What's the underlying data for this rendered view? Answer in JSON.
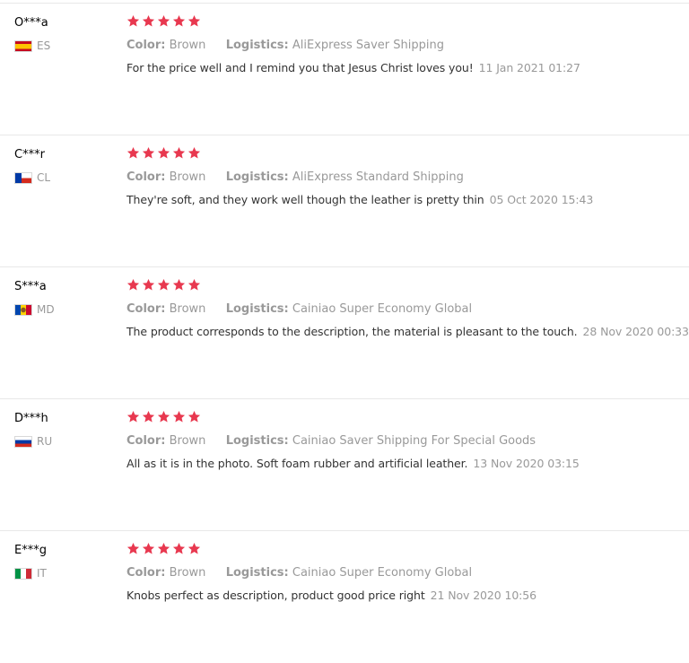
{
  "labels": {
    "color_key": "Color:",
    "logistics_key": "Logistics:"
  },
  "colors": {
    "star": "#e8384f",
    "muted_text": "#999999",
    "body_text": "#333333",
    "divider": "#e8e8e8"
  },
  "reviews": [
    {
      "user": "O***a",
      "country": "ES",
      "flag_icon": "spain-flag-icon",
      "rating": 5,
      "color": "Brown",
      "logistics": "AliExpress Saver Shipping",
      "comment": "For the price well and I remind you that Jesus Christ loves you!",
      "date": "11 Jan 2021 01:27"
    },
    {
      "user": "C***r",
      "country": "CL",
      "flag_icon": "chile-flag-icon",
      "rating": 5,
      "color": "Brown",
      "logistics": "AliExpress Standard Shipping",
      "comment": "They're soft, and they work well though the leather is pretty thin",
      "date": "05 Oct 2020 15:43"
    },
    {
      "user": "S***a",
      "country": "MD",
      "flag_icon": "moldova-flag-icon",
      "rating": 5,
      "color": "Brown",
      "logistics": "Cainiao Super Economy Global",
      "comment": "The product corresponds to the description, the material is pleasant to the touch.",
      "date": "28 Nov 2020 00:33"
    },
    {
      "user": "D***h",
      "country": "RU",
      "flag_icon": "russia-flag-icon",
      "rating": 5,
      "color": "Brown",
      "logistics": "Cainiao Saver Shipping For Special Goods",
      "comment": "All as it is in the photo. Soft foam rubber and artificial leather.",
      "date": "13 Nov 2020 03:15"
    },
    {
      "user": "E***g",
      "country": "IT",
      "flag_icon": "italy-flag-icon",
      "rating": 5,
      "color": "Brown",
      "logistics": "Cainiao Super Economy Global",
      "comment": "Knobs perfect as description, product good price right",
      "date": "21 Nov 2020 10:56"
    }
  ]
}
